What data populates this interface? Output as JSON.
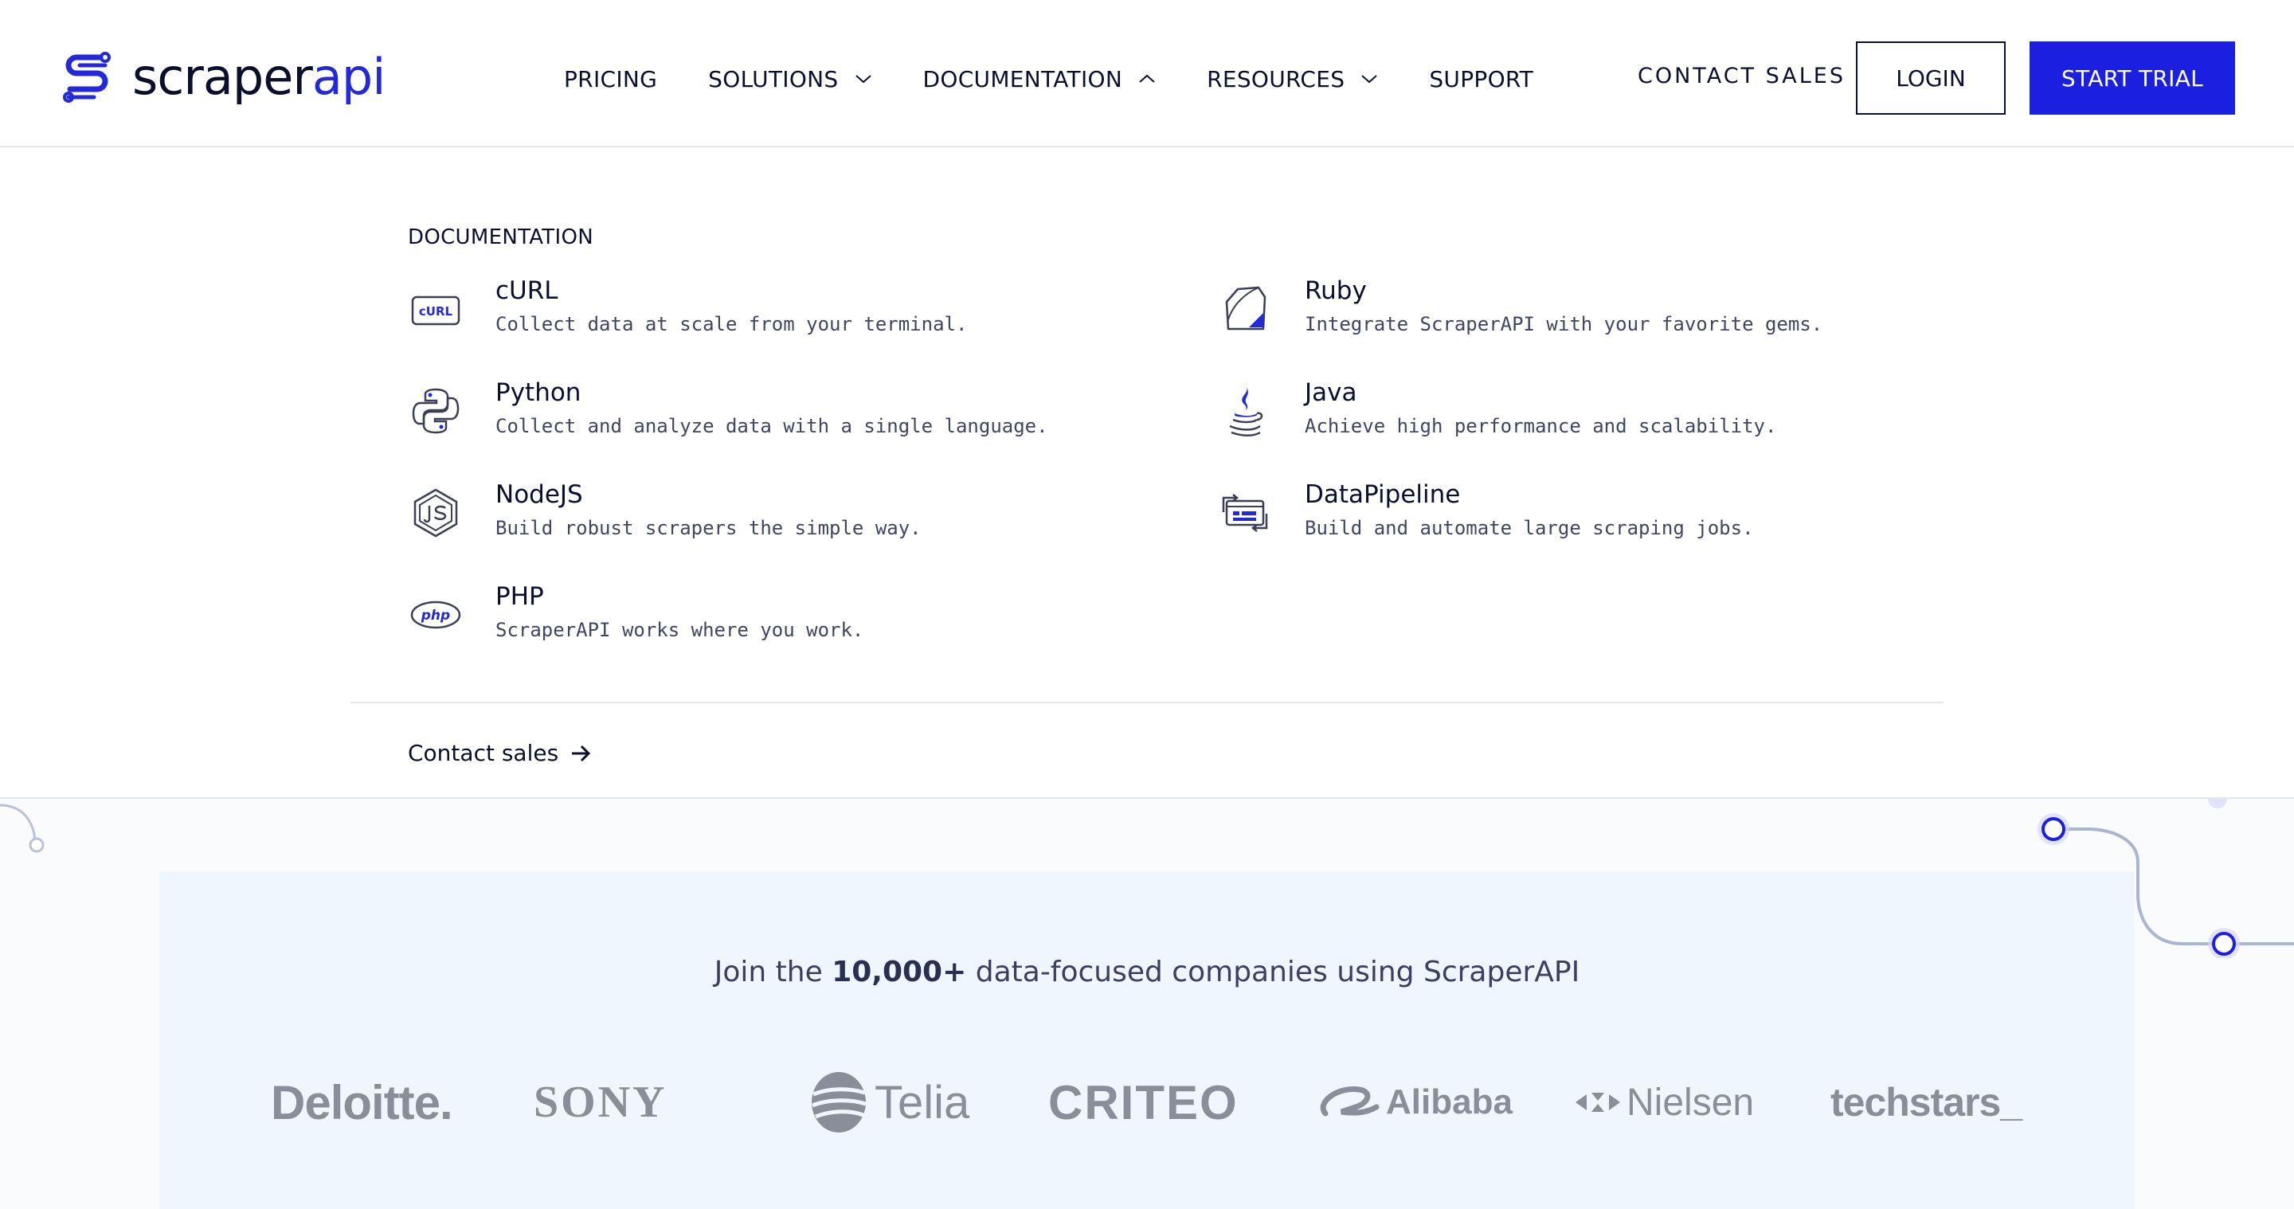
{
  "header": {
    "logo": {
      "part1": "scraper",
      "part2": "api"
    },
    "nav": [
      {
        "label": "PRICING",
        "chevron": "none"
      },
      {
        "label": "SOLUTIONS",
        "chevron": "down"
      },
      {
        "label": "DOCUMENTATION",
        "chevron": "up"
      },
      {
        "label": "RESOURCES",
        "chevron": "down"
      },
      {
        "label": "SUPPORT",
        "chevron": "none"
      }
    ],
    "contact_sales": "CONTACT SALES",
    "login": "LOGIN",
    "start_trial": "START TRIAL"
  },
  "dropdown": {
    "title": "DOCUMENTATION",
    "items": [
      {
        "name": "cURL",
        "desc": "Collect data at scale from your terminal.",
        "icon": "curl-icon",
        "icon_text": "cURL"
      },
      {
        "name": "Python",
        "desc": "Collect and analyze data with a single language.",
        "icon": "python-icon"
      },
      {
        "name": "NodeJS",
        "desc": "Build robust scrapers the simple way.",
        "icon": "nodejs-icon"
      },
      {
        "name": "PHP",
        "desc": "ScraperAPI works where you work.",
        "icon": "php-icon",
        "icon_text": "php"
      },
      {
        "name": "Ruby",
        "desc": "Integrate ScraperAPI with your favorite gems.",
        "icon": "ruby-icon"
      },
      {
        "name": "Java",
        "desc": "Achieve high performance and scalability.",
        "icon": "java-icon"
      },
      {
        "name": "DataPipeline",
        "desc": "Build and automate large scraping jobs.",
        "icon": "datapipeline-icon"
      }
    ],
    "contact_link": "Contact sales"
  },
  "social_proof": {
    "prefix": "Join the ",
    "count": "10,000+",
    "suffix": " data-focused companies using ScraperAPI",
    "logos": [
      "Deloitte.",
      "SONY",
      "Telia",
      "CRITEO",
      "Alibaba",
      "Nielsen",
      "techstars_"
    ]
  },
  "colors": {
    "brand": "#1b1fdf",
    "text": "#0b0f2e",
    "logo_gray": "#8a8e9b",
    "band": "#eff6fe"
  }
}
